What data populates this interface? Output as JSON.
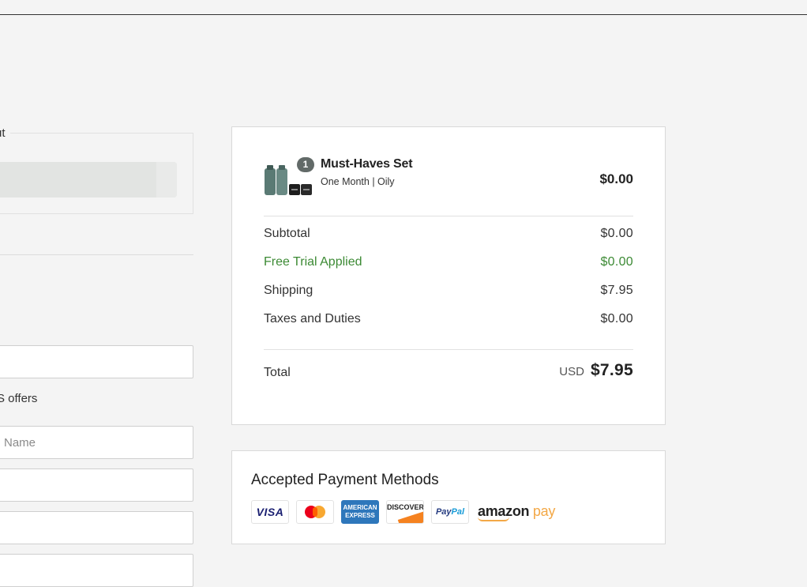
{
  "left": {
    "express_legend": "ut",
    "offers_text": "S offers",
    "first_name_placeholder": "Name"
  },
  "order": {
    "item": {
      "quantity": "1",
      "name": "Must-Haves Set",
      "variant": "One Month | Oily",
      "price": "$0.00"
    },
    "lines": [
      {
        "label": "Subtotal",
        "value": "$0.00",
        "highlight": false
      },
      {
        "label": "Free Trial Applied",
        "value": "$0.00",
        "highlight": true
      },
      {
        "label": "Shipping",
        "value": "$7.95",
        "highlight": false
      },
      {
        "label": "Taxes and Duties",
        "value": "$0.00",
        "highlight": false
      }
    ],
    "total": {
      "label": "Total",
      "currency": "USD",
      "amount": "$7.95"
    }
  },
  "payment": {
    "title": "Accepted Payment Methods",
    "methods": [
      "visa-icon",
      "mastercard-icon",
      "amex-icon",
      "discover-icon",
      "paypal-icon",
      "amazon-pay-icon"
    ],
    "visa_text": "VISA",
    "amex_text": "AMERICAN EXPRESS",
    "discover_text": "DISCOVER",
    "paypal_pay": "Pay",
    "paypal_pal": "Pal",
    "amazon_text": "amazon",
    "amazon_pay": "pay"
  },
  "colors": {
    "accent_green": "#3c8a34",
    "badge": "#626a68",
    "page_bg": "#f4f4f4"
  }
}
